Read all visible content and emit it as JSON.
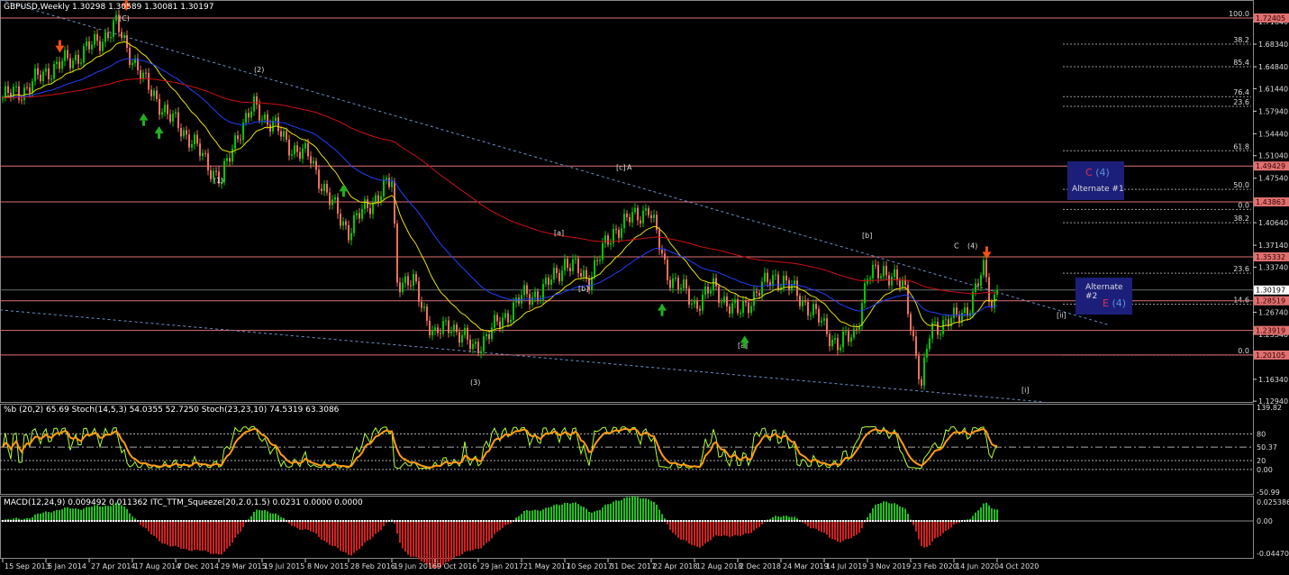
{
  "header": {
    "symbol_line": "GBPUSD,Weekly  1.30298 1.30589 1.30081 1.30197",
    "stoch_line": "%b (20,2) 65.69  Stoch(14,5,3) 54.0355 52.7250  Stoch(23,23,10) 74.5319 63.3086",
    "macd_line": "MACD(12,24,9) 0.009492 0.011362  ITC_TTM_Squeeze(20,2.0,1.5) 0.0231 0.0000 0.0000"
  },
  "colors": {
    "bull": "#00c800",
    "bear": "#f07060",
    "level": "#e07070",
    "ma20": "#e8e000",
    "ma50": "#2040ff",
    "ma200": "#d01010",
    "stoch_fast": "#adff2f",
    "stoch_slow": "#ff9a10",
    "box": "#1c1f7a"
  },
  "price_axis": [
    "1.71840",
    "1.68340",
    "1.64840",
    "1.61440",
    "1.57940",
    "1.54440",
    "1.51040",
    "1.47540",
    "1.40640",
    "1.37140",
    "1.33740",
    "1.26740",
    "1.23340",
    "1.16340",
    "1.12940"
  ],
  "levels": [
    {
      "price": 1.72405,
      "label": "1.72405"
    },
    {
      "price": 1.49429,
      "label": "1.49429"
    },
    {
      "price": 1.43863,
      "label": "1.43863"
    },
    {
      "price": 1.35332,
      "label": "1.35332"
    },
    {
      "price": 1.28519,
      "label": "1.28519"
    },
    {
      "price": 1.23919,
      "label": "1.23919"
    },
    {
      "price": 1.20105,
      "label": "1.20105"
    }
  ],
  "current_price": {
    "price": 1.30197,
    "label": "1.30197"
  },
  "fib_levels": [
    {
      "price": 1.724,
      "label": "100.0"
    },
    {
      "price": 1.6834,
      "label": "38.2"
    },
    {
      "price": 1.6484,
      "label": "85.4"
    },
    {
      "price": 1.602,
      "label": "76.4"
    },
    {
      "price": 1.587,
      "label": "23.6"
    },
    {
      "price": 1.518,
      "label": "61.8"
    },
    {
      "price": 1.458,
      "label": "50.0"
    },
    {
      "price": 1.427,
      "label": "0.0"
    },
    {
      "price": 1.4064,
      "label": "38.2"
    },
    {
      "price": 1.328,
      "label": "23.6"
    },
    {
      "price": 1.28,
      "label": "14.6"
    },
    {
      "price": 1.201,
      "label": "0.0"
    }
  ],
  "wave_labels": [
    {
      "text": "(1)",
      "date": "2015-03-15",
      "price": 1.468,
      "color": "#4a90d9"
    },
    {
      "text": "(2)",
      "date": "2015-06-28",
      "price": 1.64,
      "color": "#4a90d9"
    },
    {
      "text": "(3)",
      "date": "2017-01-08",
      "price": 1.155,
      "color": "#4a90d9"
    },
    {
      "text": "(C)",
      "date": "2014-07-13",
      "price": 1.72,
      "color": "#4a90d9"
    },
    {
      "text": "[c]",
      "date": "2018-01-21",
      "price": 1.488,
      "color": "#e8e000"
    },
    {
      "text": "A",
      "date": "2018-02-18",
      "price": 1.488,
      "color": "#e03030"
    },
    {
      "text": "[a]",
      "date": "2017-08-13",
      "price": 1.387,
      "color": "#e8e000"
    },
    {
      "text": "[b]",
      "date": "2017-10-15",
      "price": 1.3,
      "color": "#e8e000"
    },
    {
      "text": "[a]",
      "date": "2018-12-02",
      "price": 1.212,
      "color": "#e8e000"
    },
    {
      "text": "[b]",
      "date": "2019-10-20",
      "price": 1.383,
      "color": "#e8e000"
    },
    {
      "text": "C",
      "date": "2020-06-14",
      "price": 1.367,
      "color": "#e03030"
    },
    {
      "text": "(4)",
      "date": "2020-07-19",
      "price": 1.367,
      "color": "#4a90d9"
    },
    {
      "text": "[ii]",
      "date": "2021-03-07",
      "price": 1.259,
      "color": "#e8e000"
    },
    {
      "text": "[i]",
      "date": "2020-12-06",
      "price": 1.143,
      "color": "#e8e000"
    }
  ],
  "alternates": [
    {
      "wave": "C",
      "degree": "(4)",
      "name": "Alternate #1"
    },
    {
      "wave": "E",
      "degree": "(4)",
      "name": "Alternate #2"
    }
  ],
  "stoch_axis": [
    "139.82",
    "80",
    "50.37",
    "0.00",
    "20",
    "-50.99"
  ],
  "macd_axis": [
    "0.025386",
    "0.00",
    "-0.044702"
  ],
  "chart_data": {
    "type": "candlestick",
    "title": "GBPUSD, Weekly",
    "xlabel": "",
    "ylabel": "",
    "ylim": [
      1.1294,
      1.74
    ],
    "x_ticks": [
      "15 Sep 2013",
      "5 Jan 2014",
      "27 Apr 2014",
      "17 Aug 2014",
      "7 Dec 2014",
      "29 Mar 2015",
      "19 Jul 2015",
      "8 Nov 2015",
      "28 Feb 2016",
      "19 Jun 2016",
      "9 Oct 2016",
      "29 Jan 2017",
      "21 May 2017",
      "10 Sep 2017",
      "31 Dec 2017",
      "22 Apr 2018",
      "12 Aug 2018",
      "2 Dec 2018",
      "24 Mar 2019",
      "14 Jul 2019",
      "3 Nov 2019",
      "23 Feb 2020",
      "14 Jun 2020",
      "4 Oct 2020"
    ],
    "last_bar": {
      "open": 1.30298,
      "high": 1.30589,
      "low": 1.30081,
      "close": 1.30197
    },
    "approx_closes": [
      [
        "2013-09-15",
        1.6
      ],
      [
        "2013-11-15",
        1.615
      ],
      [
        "2014-01-15",
        1.645
      ],
      [
        "2014-03-15",
        1.66
      ],
      [
        "2014-05-15",
        1.685
      ],
      [
        "2014-07-06",
        1.712
      ],
      [
        "2014-08-15",
        1.665
      ],
      [
        "2014-09-15",
        1.625
      ],
      [
        "2014-10-15",
        1.605
      ],
      [
        "2014-11-15",
        1.57
      ],
      [
        "2014-12-15",
        1.56
      ],
      [
        "2015-02-01",
        1.52
      ],
      [
        "2015-04-05",
        1.47
      ],
      [
        "2015-05-15",
        1.545
      ],
      [
        "2015-06-28",
        1.585
      ],
      [
        "2015-08-15",
        1.56
      ],
      [
        "2015-09-20",
        1.53
      ],
      [
        "2015-11-22",
        1.505
      ],
      [
        "2016-01-10",
        1.44
      ],
      [
        "2016-02-28",
        1.395
      ],
      [
        "2016-04-20",
        1.435
      ],
      [
        "2016-06-19",
        1.47
      ],
      [
        "2016-07-03",
        1.32
      ],
      [
        "2016-08-15",
        1.31
      ],
      [
        "2016-10-09",
        1.23
      ],
      [
        "2016-11-20",
        1.25
      ],
      [
        "2017-01-15",
        1.21
      ],
      [
        "2017-03-15",
        1.245
      ],
      [
        "2017-05-21",
        1.29
      ],
      [
        "2017-07-15",
        1.3
      ],
      [
        "2017-09-10",
        1.345
      ],
      [
        "2017-11-10",
        1.32
      ],
      [
        "2018-01-15",
        1.395
      ],
      [
        "2018-04-15",
        1.43
      ],
      [
        "2018-06-01",
        1.33
      ],
      [
        "2018-08-12",
        1.28
      ],
      [
        "2018-10-01",
        1.305
      ],
      [
        "2018-12-02",
        1.265
      ],
      [
        "2019-01-15",
        1.295
      ],
      [
        "2019-03-10",
        1.325
      ],
      [
        "2019-05-15",
        1.29
      ],
      [
        "2019-07-14",
        1.245
      ],
      [
        "2019-08-20",
        1.215
      ],
      [
        "2019-10-01",
        1.235
      ],
      [
        "2019-11-03",
        1.32
      ],
      [
        "2019-12-15",
        1.335
      ],
      [
        "2020-02-10",
        1.3
      ],
      [
        "2020-03-22",
        1.15
      ],
      [
        "2020-04-15",
        1.245
      ],
      [
        "2020-06-14",
        1.255
      ],
      [
        "2020-07-26",
        1.28
      ],
      [
        "2020-09-01",
        1.335
      ],
      [
        "2020-09-20",
        1.28
      ],
      [
        "2020-10-04",
        1.302
      ]
    ]
  }
}
